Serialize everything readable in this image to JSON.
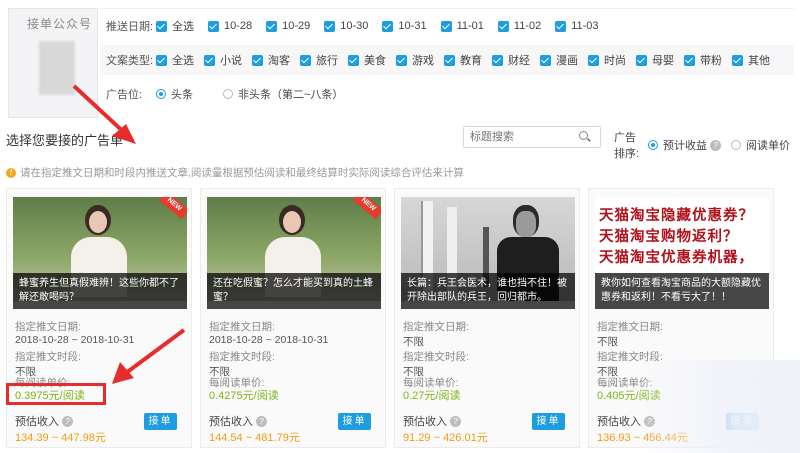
{
  "account": {
    "label": "接单公众号"
  },
  "filters": {
    "date": {
      "label": "推送日期:",
      "options": [
        "全选",
        "10-28",
        "10-29",
        "10-30",
        "10-31",
        "11-01",
        "11-02",
        "11-03"
      ]
    },
    "category": {
      "label": "文案类型:",
      "options": [
        "全选",
        "小说",
        "淘客",
        "旅行",
        "美食",
        "游戏",
        "教育",
        "财经",
        "漫画",
        "时尚",
        "母婴",
        "带粉",
        "其他"
      ]
    },
    "ad_position": {
      "label": "广告位:",
      "options": [
        "头条",
        "非头条（第二~八条）"
      ],
      "selected": "头条"
    }
  },
  "section": {
    "title": "选择您要接的广告单",
    "search_placeholder": "标题搜索",
    "sort_label": "广告排序:",
    "sort_options": [
      "预计收益",
      "阅读单价"
    ],
    "sort_selected": "预计收益",
    "notice": "请在指定推文日期和时段内推送文章,阅读量根据预估阅读和最终结算时实际阅读综合评估来计算"
  },
  "card_labels": {
    "date_label": "指定推文日期:",
    "period_label": "指定推文时段:",
    "price_label": "每阅读单价:",
    "est_label": "预估收入",
    "take_button": "接单",
    "new_badge": "NEW"
  },
  "cards": [
    {
      "caption": "蜂蜜养生但真假难辨！这些你都不了解还敢喝吗？",
      "date": "2018-10-28 ~ 2018-10-31",
      "period": "不限",
      "price": "0.3975元/阅读",
      "estimate": "134.39 ~ 447.98元",
      "is_new": true
    },
    {
      "caption": "还在吃假蜜？怎么才能买到真的土蜂蜜？",
      "date": "2018-10-28 ~ 2018-10-31",
      "period": "不限",
      "price": "0.4275元/阅读",
      "estimate": "144.54 ~ 481.79元",
      "is_new": true
    },
    {
      "caption": "长篇：兵王会医术，谁也挡不住！被开除出部队的兵王，回归都市。",
      "date": "不限",
      "period": "不限",
      "price": "0.27元/阅读",
      "estimate": "91.29 ~ 426.01元",
      "is_new": false
    },
    {
      "caption": "教你如何查看淘宝商品的大额隐藏优惠券和返利！不看亏大了！！",
      "date": "不限",
      "period": "不限",
      "price": "0.405元/阅读",
      "estimate": "136.93 ~ 456.44元",
      "is_new": false,
      "image_lines": [
        "天猫淘宝隐藏优惠券？",
        "天猫淘宝购物返利？",
        "天猫淘宝优惠券机器，"
      ]
    }
  ],
  "colors": {
    "accent": "#1e9de0",
    "price_green": "#7cb518",
    "estimate_orange": "#f39c12",
    "annotation_red": "#e62c2c"
  }
}
